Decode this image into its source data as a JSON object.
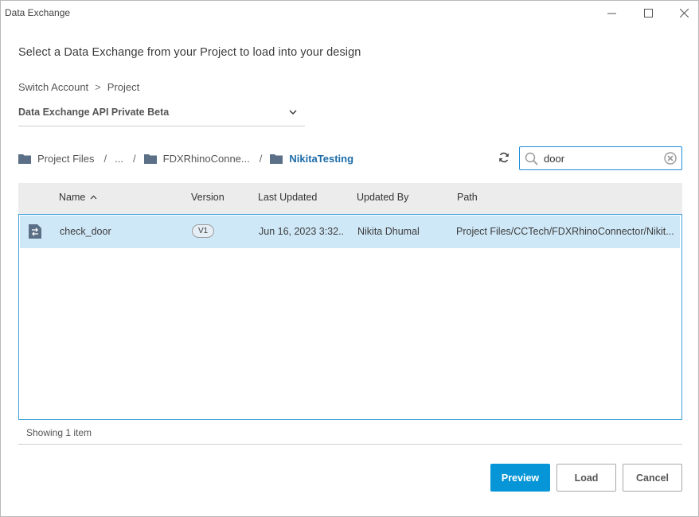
{
  "window": {
    "title": "Data Exchange"
  },
  "heading": "Select a Data Exchange from your Project to load into your design",
  "account_breadcrumb": {
    "switch_account": "Switch Account",
    "separator": ">",
    "project": "Project"
  },
  "project_select": {
    "value": "Data Exchange API Private Beta"
  },
  "path": {
    "items": [
      {
        "label": "Project Files"
      },
      {
        "label": "..."
      },
      {
        "label": "FDXRhinoConne..."
      },
      {
        "label": "NikitaTesting"
      }
    ],
    "separator": "/"
  },
  "search": {
    "value": "door",
    "placeholder": ""
  },
  "table": {
    "columns": {
      "name": "Name",
      "version": "Version",
      "last_updated": "Last Updated",
      "updated_by": "Updated By",
      "path": "Path"
    },
    "sort_indicator": "^",
    "rows": [
      {
        "name": "check_door",
        "version": "V1",
        "last_updated": "Jun 16, 2023 3:32...",
        "updated_by": "Nikita Dhumal",
        "path": "Project Files/CCTech/FDXRhinoConnector/Nikit..."
      }
    ]
  },
  "status": "Showing 1 item",
  "buttons": {
    "preview": "Preview",
    "load": "Load",
    "cancel": "Cancel"
  },
  "colors": {
    "accent": "#0696d7",
    "selected_row": "#cfe8f7",
    "folder_icon": "#5b6f86",
    "current_path": "#1c6ba8"
  }
}
